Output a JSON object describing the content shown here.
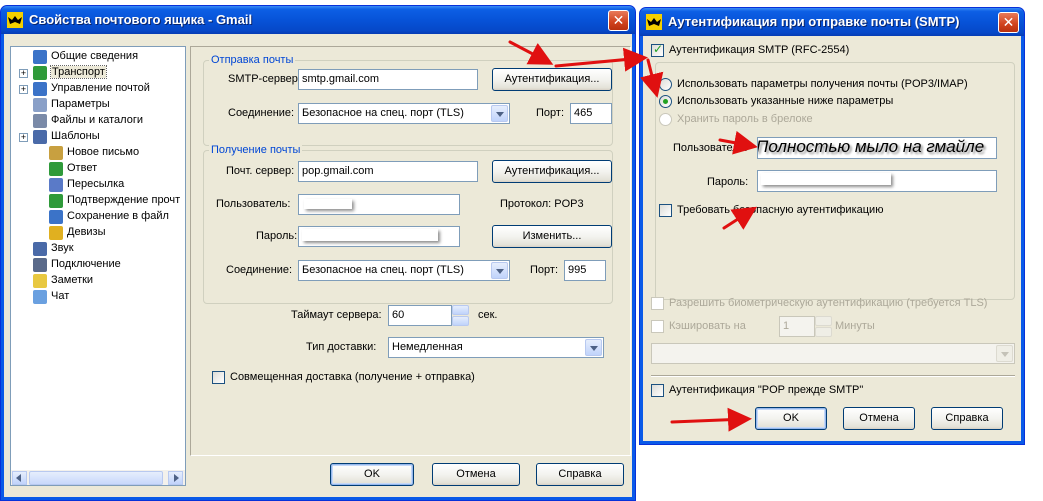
{
  "left_window": {
    "title": "Свойства почтового ящика - Gmail",
    "tree": [
      {
        "label": "Общие сведения",
        "icon_color": "#3b73c8"
      },
      {
        "label": "Транспорт",
        "icon_color": "#2f9a3a",
        "selected": true
      },
      {
        "label": "Управление почтой",
        "icon_color": "#3b73c8"
      },
      {
        "label": "Параметры",
        "icon_color": "#8aa0c8"
      },
      {
        "label": "Файлы и каталоги",
        "icon_color": "#7a8aa8"
      },
      {
        "label": "Шаблоны",
        "icon_color": "#4a6aa8"
      },
      {
        "label": "Новое письмо",
        "icon_color": "#c8a040"
      },
      {
        "label": "Ответ",
        "icon_color": "#2f9a3a"
      },
      {
        "label": "Пересылка",
        "icon_color": "#5a7ac8"
      },
      {
        "label": "Подтверждение прочт",
        "icon_color": "#2f9a3a"
      },
      {
        "label": "Сохранение в файл",
        "icon_color": "#3b73c8"
      },
      {
        "label": "Девизы",
        "icon_color": "#e0b020"
      },
      {
        "label": "Звук",
        "icon_color": "#4a6aa8"
      },
      {
        "label": "Подключение",
        "icon_color": "#5a6a8a"
      },
      {
        "label": "Заметки",
        "icon_color": "#e8c840"
      },
      {
        "label": "Чат",
        "icon_color": "#6aa0e0"
      }
    ],
    "outgoing": {
      "title": "Отправка почты",
      "smtp_label": "SMTP-сервер:",
      "smtp_value": "smtp.gmail.com",
      "auth_button": "Аутентификация...",
      "conn_label": "Соединение:",
      "conn_value": "Безопасное на спец. порт (TLS)",
      "port_label": "Порт:",
      "port_value": "465"
    },
    "incoming": {
      "title": "Получение почты",
      "server_label": "Почт. сервер:",
      "server_value": "pop.gmail.com",
      "auth_button": "Аутентификация...",
      "user_label": "Пользователь:",
      "protocol_text": "Протокол:  POP3",
      "pass_label": "Пароль:",
      "change_button": "Изменить...",
      "conn_label": "Соединение:",
      "conn_value": "Безопасное на спец. порт (TLS)",
      "port_label": "Порт:",
      "port_value": "995"
    },
    "timeout_label": "Таймаут сервера:",
    "timeout_value": "60",
    "timeout_unit": "сек.",
    "delivery_label": "Тип доставки:",
    "delivery_value": "Немедленная",
    "combined_label": "Совмещенная доставка (получение + отправка)",
    "ok": "OK",
    "cancel": "Отмена",
    "help": "Справка"
  },
  "right_window": {
    "title": "Аутентификация при отправке почты (SMTP)",
    "smtp_auth_label": "Аутентификация SMTP (RFC-2554)",
    "radio1": "Использовать параметры получения почты (POP3/IMAP)",
    "radio2": "Использовать указанные ниже параметры",
    "radio3": "Хранить пароль в брелоке",
    "user_label": "Пользователь:",
    "user_value": "Полностью мыло на гмайле",
    "pass_label": "Пароль:",
    "secure_label": "Требовать безопасную аутентификацию",
    "bio_label": "Разрешить биометрическую аутентификацию (требуется TLS)",
    "cache_label": "Кэшировать на",
    "cache_value": "1",
    "cache_unit": "Минуты",
    "pop_before_label": "Аутентификация \"POP прежде SMTP\"",
    "ok": "OK",
    "cancel": "Отмена",
    "help": "Справка"
  },
  "colors": {
    "titlebar": "#0753d8",
    "dialog_bg": "#ece9d8",
    "group_title": "#0046d5",
    "annotation_arrow": "#e01010"
  }
}
